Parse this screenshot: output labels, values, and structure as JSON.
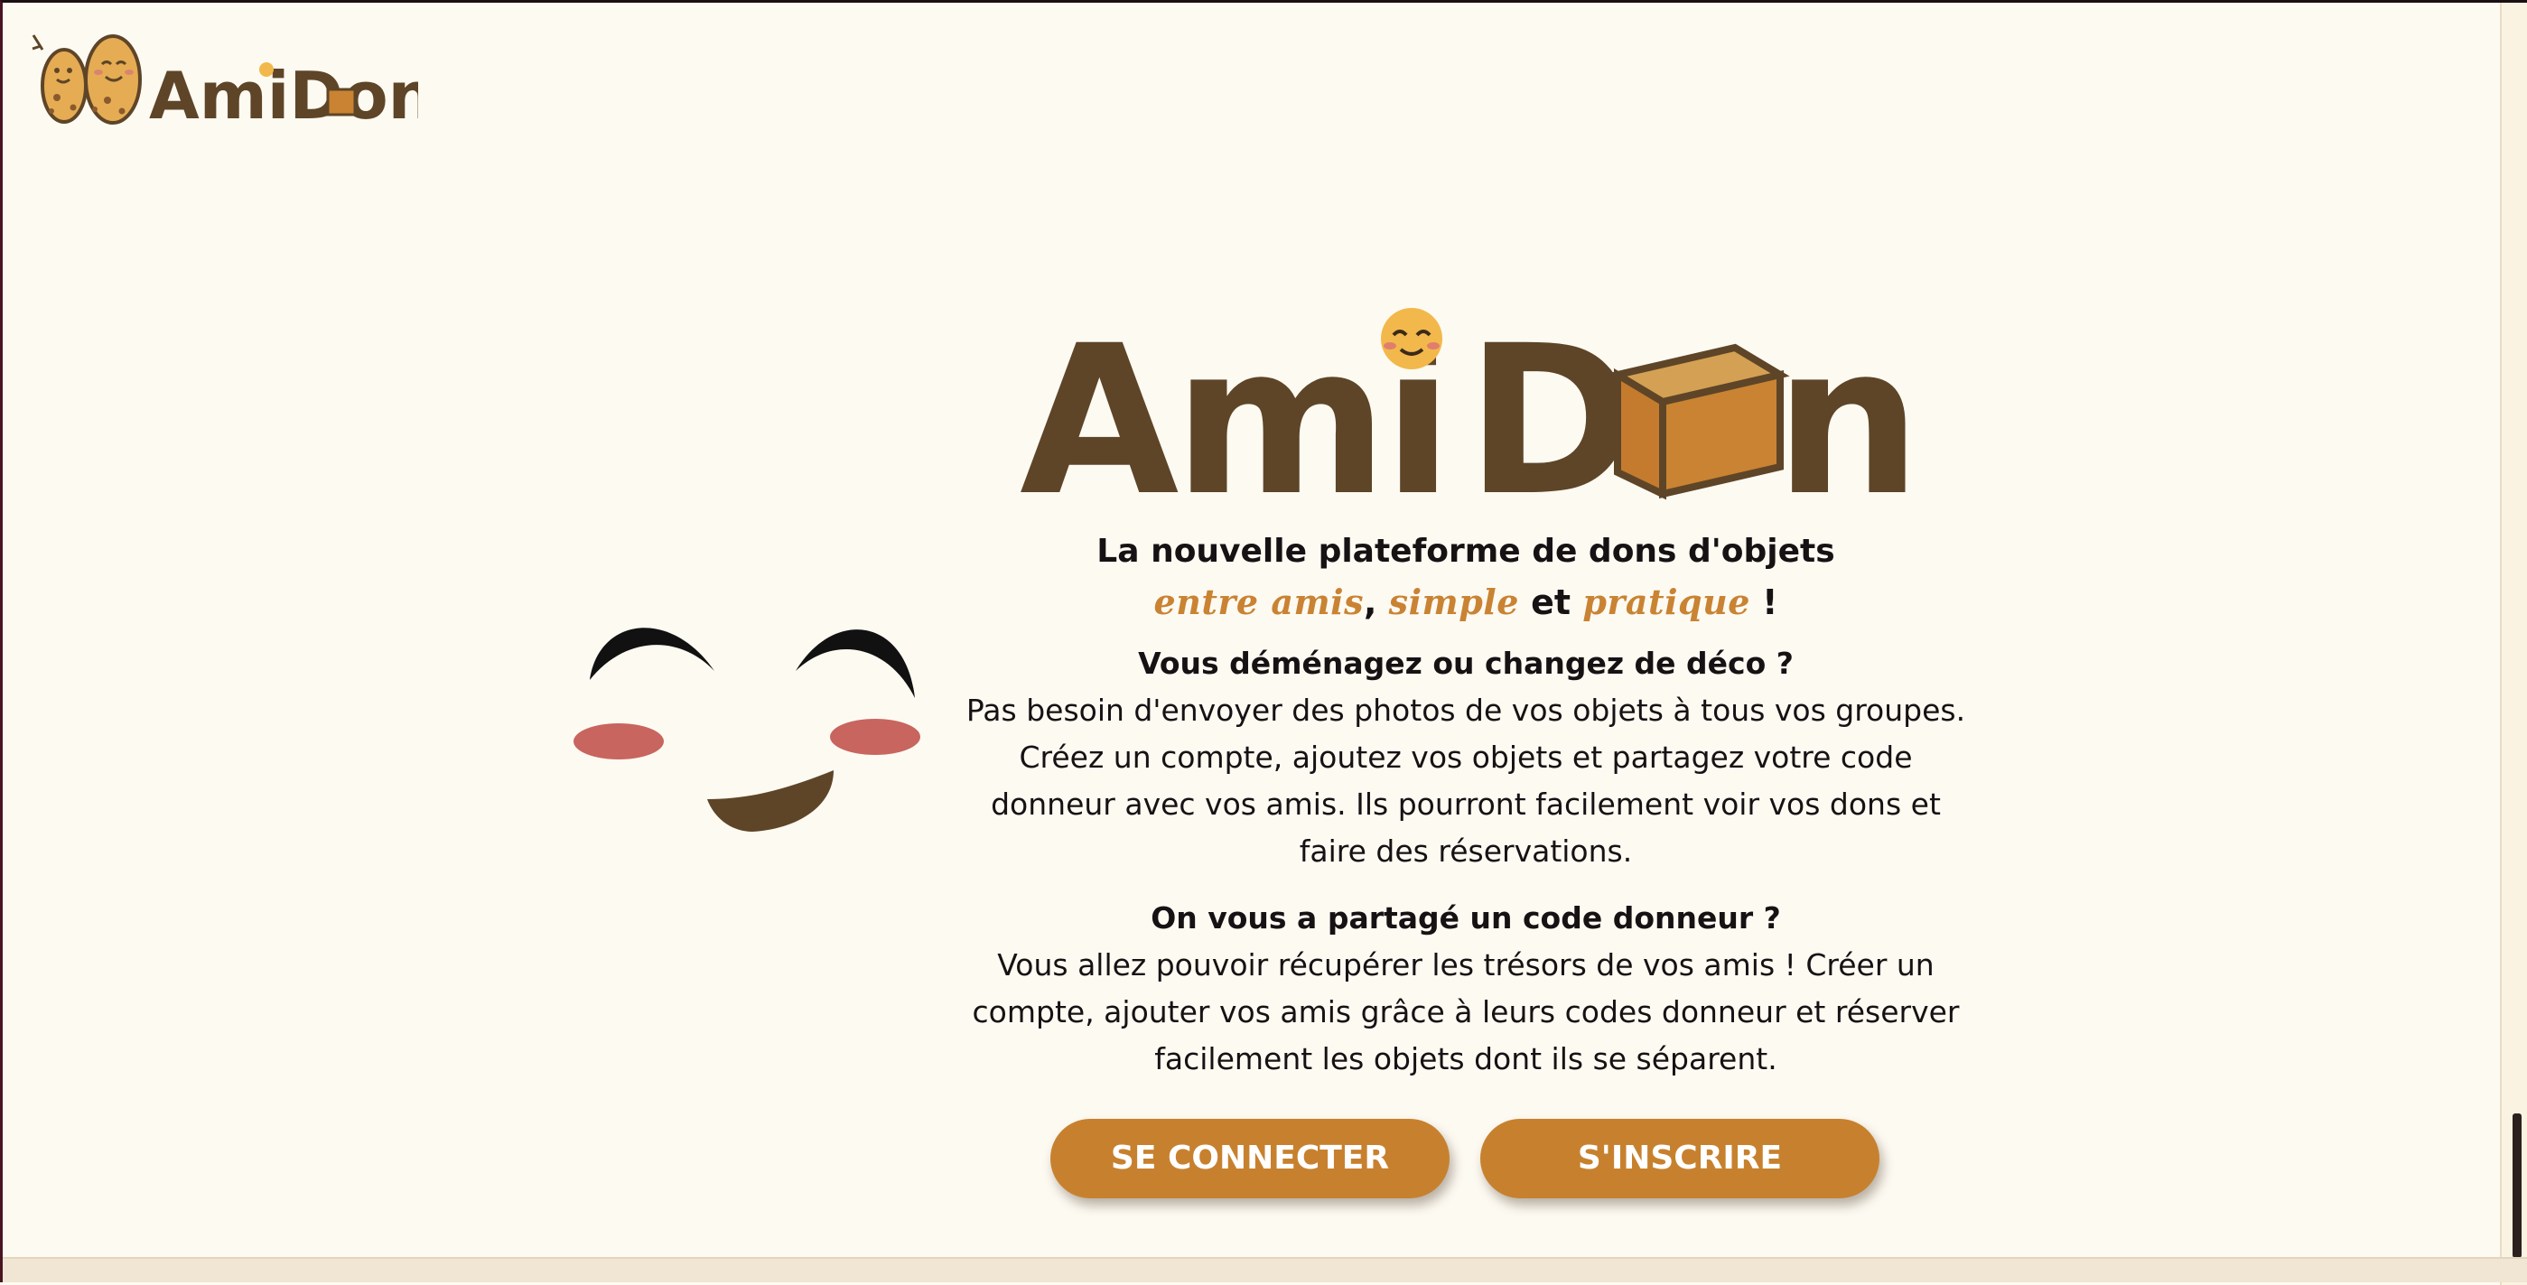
{
  "header": {
    "logo_text": "AmiDon"
  },
  "hero": {
    "logo_text": "AmiDon",
    "tagline_line1": "La nouvelle plateforme de dons d'objets",
    "tagline_accent1": "entre amis",
    "tagline_sep1": ", ",
    "tagline_accent2": "simple",
    "tagline_and": " et ",
    "tagline_accent3": "pratique",
    "tagline_end": " !"
  },
  "sections": [
    {
      "title": "Vous déménagez ou changez de déco ?",
      "body": "Pas besoin d'envoyer des photos de vos objets à tous vos groupes. Créez un compte, ajoutez vos objets et partagez votre code donneur avec vos amis. Ils pourront facilement voir vos dons et faire des réservations."
    },
    {
      "title": "On vous a partagé un code donneur ?",
      "body": "Vous allez pouvoir récupérer les trésors de vos amis ! Créer un compte, ajouter vos amis grâce à leurs codes donneur et réserver facilement les objets dont ils se séparent."
    }
  ],
  "buttons": {
    "login": "SE CONNECTER",
    "signup": "S'INSCRIRE"
  },
  "colors": {
    "background": "#fdfaf2",
    "brand_brown": "#5e4528",
    "accent_orange": "#c7812e",
    "box_orange": "#c98332",
    "blush": "#c8655f"
  },
  "icons": {
    "face": "smiling-face-icon",
    "header_mascots": "potato-mascots-icon",
    "box": "cardboard-box-icon"
  }
}
